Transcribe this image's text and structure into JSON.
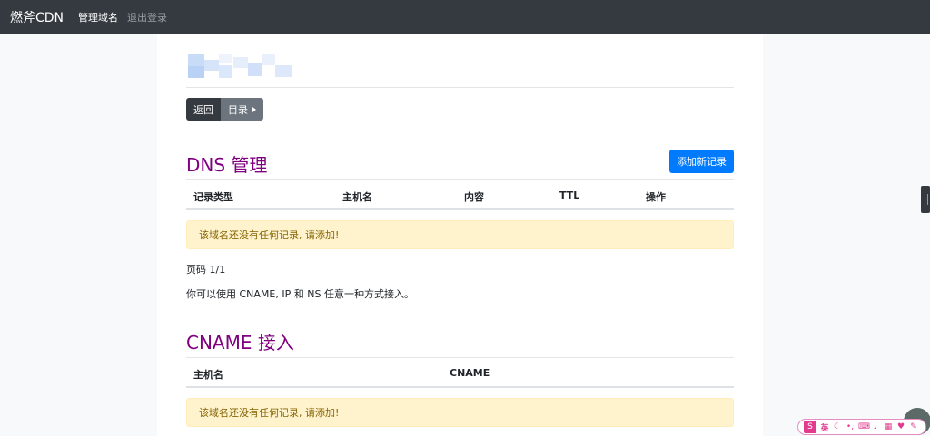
{
  "navbar": {
    "brand": "燃斧CDN",
    "links": [
      "管理域名",
      "退出登录"
    ]
  },
  "toolbar": {
    "back_label": "返回",
    "directory_label": "目录"
  },
  "dns": {
    "title": "DNS 管理",
    "add_button": "添加新记录",
    "columns": [
      "记录类型",
      "主机名",
      "内容",
      "TTL",
      "操作"
    ],
    "empty_message": "该域名还没有任何记录, 请添加!",
    "pagination": "页码 1/1",
    "note": "你可以使用 CNAME, IP 和 NS 任意一种方式接入。"
  },
  "cname": {
    "title": "CNAME 接入",
    "columns": [
      "主机名",
      "CNAME"
    ],
    "empty_message": "该域名还没有任何记录, 请添加!"
  },
  "ime": {
    "logo": "S",
    "mode": "英",
    "icons": [
      "moon-icon",
      "punctuation-icon",
      "keyboard-icon",
      "microphone-icon",
      "toolbox-icon",
      "skin-icon",
      "settings-icon"
    ]
  }
}
